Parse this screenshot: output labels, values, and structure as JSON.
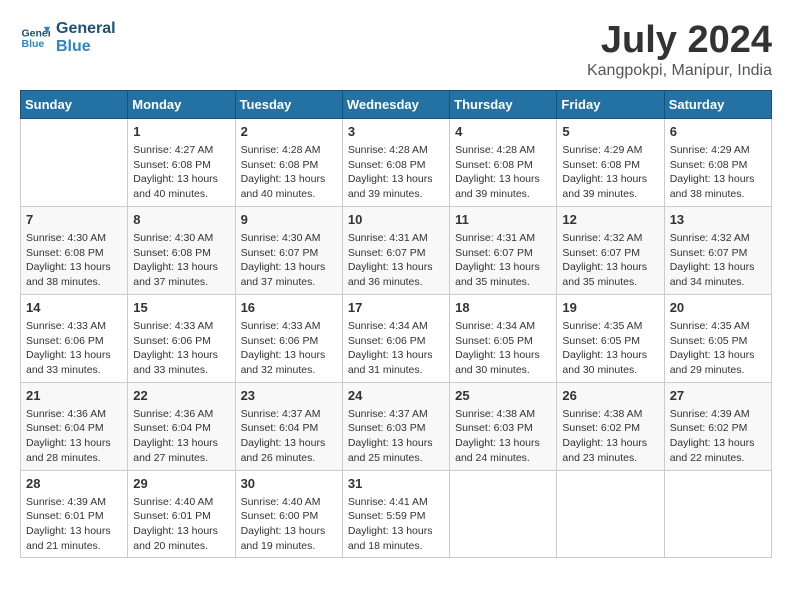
{
  "header": {
    "logo_line1": "General",
    "logo_line2": "Blue",
    "title": "July 2024",
    "subtitle": "Kangpokpi, Manipur, India"
  },
  "calendar": {
    "days_of_week": [
      "Sunday",
      "Monday",
      "Tuesday",
      "Wednesday",
      "Thursday",
      "Friday",
      "Saturday"
    ],
    "weeks": [
      [
        {
          "day": "",
          "info": ""
        },
        {
          "day": "1",
          "info": "Sunrise: 4:27 AM\nSunset: 6:08 PM\nDaylight: 13 hours\nand 40 minutes."
        },
        {
          "day": "2",
          "info": "Sunrise: 4:28 AM\nSunset: 6:08 PM\nDaylight: 13 hours\nand 40 minutes."
        },
        {
          "day": "3",
          "info": "Sunrise: 4:28 AM\nSunset: 6:08 PM\nDaylight: 13 hours\nand 39 minutes."
        },
        {
          "day": "4",
          "info": "Sunrise: 4:28 AM\nSunset: 6:08 PM\nDaylight: 13 hours\nand 39 minutes."
        },
        {
          "day": "5",
          "info": "Sunrise: 4:29 AM\nSunset: 6:08 PM\nDaylight: 13 hours\nand 39 minutes."
        },
        {
          "day": "6",
          "info": "Sunrise: 4:29 AM\nSunset: 6:08 PM\nDaylight: 13 hours\nand 38 minutes."
        }
      ],
      [
        {
          "day": "7",
          "info": "Sunrise: 4:30 AM\nSunset: 6:08 PM\nDaylight: 13 hours\nand 38 minutes."
        },
        {
          "day": "8",
          "info": "Sunrise: 4:30 AM\nSunset: 6:08 PM\nDaylight: 13 hours\nand 37 minutes."
        },
        {
          "day": "9",
          "info": "Sunrise: 4:30 AM\nSunset: 6:07 PM\nDaylight: 13 hours\nand 37 minutes."
        },
        {
          "day": "10",
          "info": "Sunrise: 4:31 AM\nSunset: 6:07 PM\nDaylight: 13 hours\nand 36 minutes."
        },
        {
          "day": "11",
          "info": "Sunrise: 4:31 AM\nSunset: 6:07 PM\nDaylight: 13 hours\nand 35 minutes."
        },
        {
          "day": "12",
          "info": "Sunrise: 4:32 AM\nSunset: 6:07 PM\nDaylight: 13 hours\nand 35 minutes."
        },
        {
          "day": "13",
          "info": "Sunrise: 4:32 AM\nSunset: 6:07 PM\nDaylight: 13 hours\nand 34 minutes."
        }
      ],
      [
        {
          "day": "14",
          "info": "Sunrise: 4:33 AM\nSunset: 6:06 PM\nDaylight: 13 hours\nand 33 minutes."
        },
        {
          "day": "15",
          "info": "Sunrise: 4:33 AM\nSunset: 6:06 PM\nDaylight: 13 hours\nand 33 minutes."
        },
        {
          "day": "16",
          "info": "Sunrise: 4:33 AM\nSunset: 6:06 PM\nDaylight: 13 hours\nand 32 minutes."
        },
        {
          "day": "17",
          "info": "Sunrise: 4:34 AM\nSunset: 6:06 PM\nDaylight: 13 hours\nand 31 minutes."
        },
        {
          "day": "18",
          "info": "Sunrise: 4:34 AM\nSunset: 6:05 PM\nDaylight: 13 hours\nand 30 minutes."
        },
        {
          "day": "19",
          "info": "Sunrise: 4:35 AM\nSunset: 6:05 PM\nDaylight: 13 hours\nand 30 minutes."
        },
        {
          "day": "20",
          "info": "Sunrise: 4:35 AM\nSunset: 6:05 PM\nDaylight: 13 hours\nand 29 minutes."
        }
      ],
      [
        {
          "day": "21",
          "info": "Sunrise: 4:36 AM\nSunset: 6:04 PM\nDaylight: 13 hours\nand 28 minutes."
        },
        {
          "day": "22",
          "info": "Sunrise: 4:36 AM\nSunset: 6:04 PM\nDaylight: 13 hours\nand 27 minutes."
        },
        {
          "day": "23",
          "info": "Sunrise: 4:37 AM\nSunset: 6:04 PM\nDaylight: 13 hours\nand 26 minutes."
        },
        {
          "day": "24",
          "info": "Sunrise: 4:37 AM\nSunset: 6:03 PM\nDaylight: 13 hours\nand 25 minutes."
        },
        {
          "day": "25",
          "info": "Sunrise: 4:38 AM\nSunset: 6:03 PM\nDaylight: 13 hours\nand 24 minutes."
        },
        {
          "day": "26",
          "info": "Sunrise: 4:38 AM\nSunset: 6:02 PM\nDaylight: 13 hours\nand 23 minutes."
        },
        {
          "day": "27",
          "info": "Sunrise: 4:39 AM\nSunset: 6:02 PM\nDaylight: 13 hours\nand 22 minutes."
        }
      ],
      [
        {
          "day": "28",
          "info": "Sunrise: 4:39 AM\nSunset: 6:01 PM\nDaylight: 13 hours\nand 21 minutes."
        },
        {
          "day": "29",
          "info": "Sunrise: 4:40 AM\nSunset: 6:01 PM\nDaylight: 13 hours\nand 20 minutes."
        },
        {
          "day": "30",
          "info": "Sunrise: 4:40 AM\nSunset: 6:00 PM\nDaylight: 13 hours\nand 19 minutes."
        },
        {
          "day": "31",
          "info": "Sunrise: 4:41 AM\nSunset: 5:59 PM\nDaylight: 13 hours\nand 18 minutes."
        },
        {
          "day": "",
          "info": ""
        },
        {
          "day": "",
          "info": ""
        },
        {
          "day": "",
          "info": ""
        }
      ]
    ]
  }
}
